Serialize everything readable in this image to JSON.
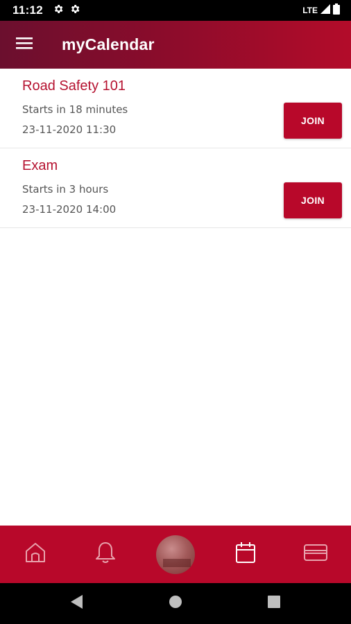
{
  "status_bar": {
    "time": "11:12",
    "network": "LTE"
  },
  "app_bar": {
    "title": "myCalendar"
  },
  "events": [
    {
      "title": "Road Safety 101",
      "starts": "Starts in 18 minutes",
      "datetime": "23-11-2020 11:30",
      "join_label": "JOIN"
    },
    {
      "title": "Exam",
      "starts": "Starts in 3 hours",
      "datetime": "23-11-2020 14:00",
      "join_label": "JOIN"
    }
  ],
  "bottom_nav": {
    "items": [
      "home-icon",
      "bell-icon",
      "avatar",
      "calendar-icon",
      "card-icon"
    ],
    "active": "calendar-icon"
  },
  "colors": {
    "brand": "#b8082a",
    "brand_dark": "#6b0f2e",
    "event_title": "#b5112f",
    "muted_text": "#555555"
  }
}
